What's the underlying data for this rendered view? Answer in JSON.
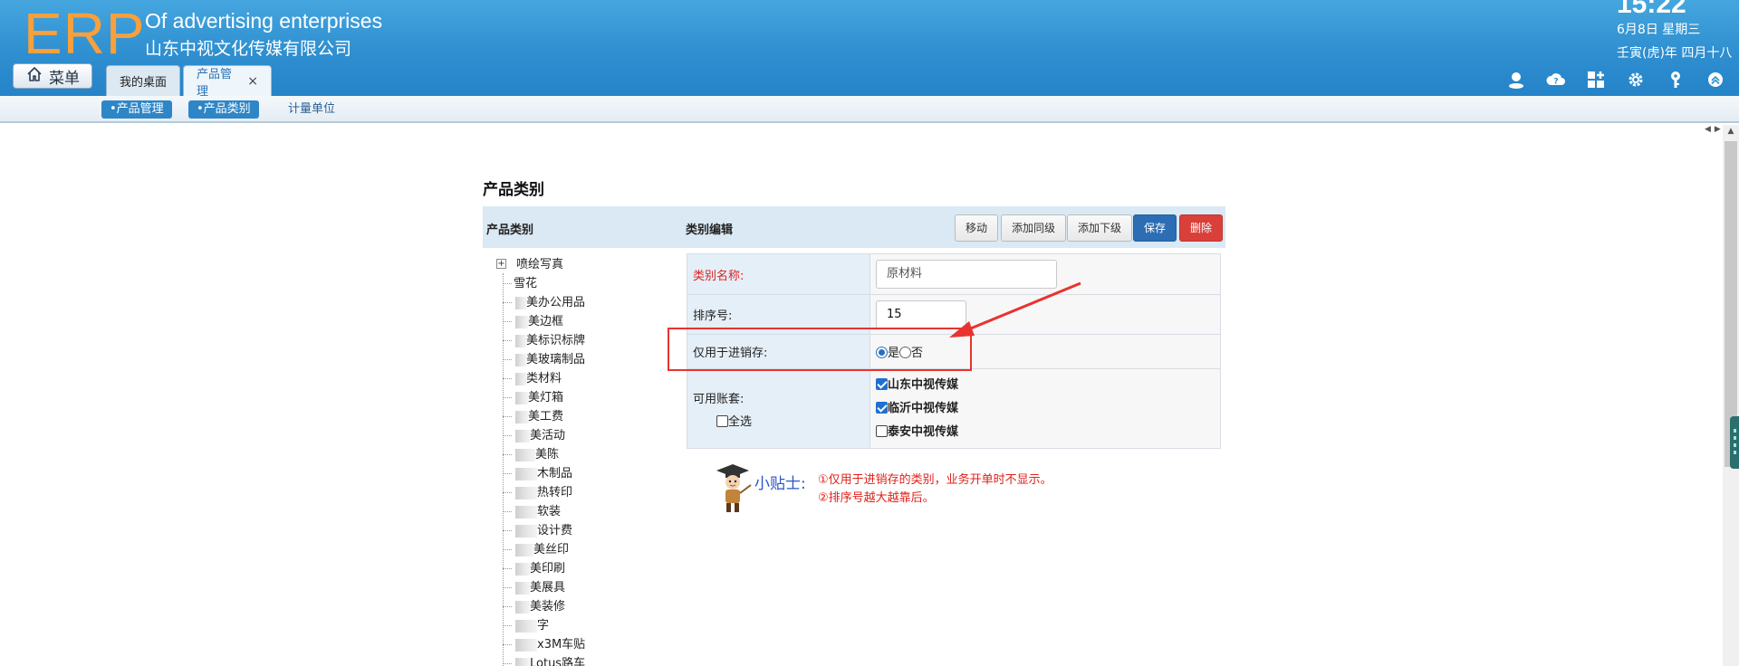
{
  "header": {
    "logo": "ERP",
    "company_en": "Of advertising enterprises",
    "company_cn": "山东中视文化传媒有限公司",
    "time": "15:22",
    "date": "6月8日 星期三",
    "lunar": "壬寅(虎)年 四月十八"
  },
  "menu_button": {
    "label": "菜单",
    "icon": "home-icon"
  },
  "tabs": [
    {
      "label": "我的桌面",
      "active": false
    },
    {
      "label": "产品管理",
      "active": true,
      "close": "×"
    }
  ],
  "header_icons": [
    "user-icon",
    "help-cloud-icon",
    "apps-icon",
    "gear-icon",
    "key-icon",
    "collapse-up-icon"
  ],
  "subnav": {
    "items": [
      {
        "label": "•产品管理",
        "active": true
      },
      {
        "label": "•产品类别",
        "active": true
      },
      {
        "label": "计量单位",
        "active": false
      }
    ]
  },
  "page": {
    "title": "产品类别",
    "left_header": "产品类别",
    "right_header": "类别编辑",
    "buttons": {
      "move": "移动",
      "add_sibling": "添加同级",
      "add_child": "添加下级",
      "save": "保存",
      "delete": "删除"
    }
  },
  "tree": {
    "expander": "+",
    "root": "喷绘写真",
    "items": [
      "雪花",
      "美办公用品",
      "美边框",
      "美标识标牌",
      "美玻璃制品",
      "类材料",
      "美灯箱",
      "美工费",
      "美活动",
      "美陈",
      "木制品",
      "热转印",
      "软装",
      "设计费",
      "美丝印",
      "美印刷",
      "美展具",
      "美装修",
      "字",
      "x3M车贴",
      "Lotus路车"
    ]
  },
  "form": {
    "name_label": "类别名称:",
    "name_value": "原材料",
    "order_label": "排序号:",
    "order_value": "15",
    "stock_only_label": "仅用于进销存:",
    "stock_yes": "是",
    "stock_no": "否",
    "stock_only_value": "是",
    "accounts_label": "可用账套:",
    "select_all": "全选",
    "accounts": [
      {
        "name": "山东中视传媒",
        "checked": true
      },
      {
        "name": "临沂中视传媒",
        "checked": true
      },
      {
        "name": "泰安中视传媒",
        "checked": false
      }
    ]
  },
  "tips": {
    "title": "小贴士:",
    "line1": "①仅用于进销存的类别，业务开单时不显示。",
    "line2": "②排序号越大越靠后。"
  },
  "colors": {
    "header_blue": "#2f8fd0",
    "logo_orange": "#f7a03c",
    "primary": "#2c6db3",
    "danger": "#d9403a",
    "annotation_red": "#e8332f"
  }
}
